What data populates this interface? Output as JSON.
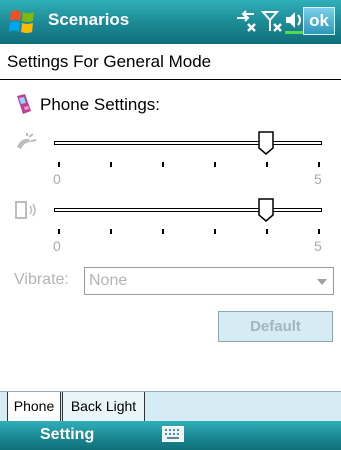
{
  "title_bar": {
    "title": "Scenarios",
    "ok_label": "ok"
  },
  "heading": "Settings For General Mode",
  "phone_settings": {
    "label": "Phone Settings:"
  },
  "ring_slider": {
    "min_label": "0",
    "max_label": "5",
    "value": 4,
    "max": 5,
    "icon": "ringer-icon"
  },
  "notify_slider": {
    "min_label": "0",
    "max_label": "5",
    "value": 4,
    "max": 5,
    "icon": "notification-icon"
  },
  "vibrate": {
    "label": "Vibrate:",
    "value": "None"
  },
  "default_button": "Default",
  "tabs": [
    {
      "label": "Phone",
      "active": true
    },
    {
      "label": "Back Light",
      "active": false
    }
  ],
  "softkeys": {
    "left": "Setting"
  },
  "colors": {
    "titlebar": "#1f8f9a",
    "tab_strip": "#d6ecf4",
    "disabled_text": "#b4b4b4"
  }
}
